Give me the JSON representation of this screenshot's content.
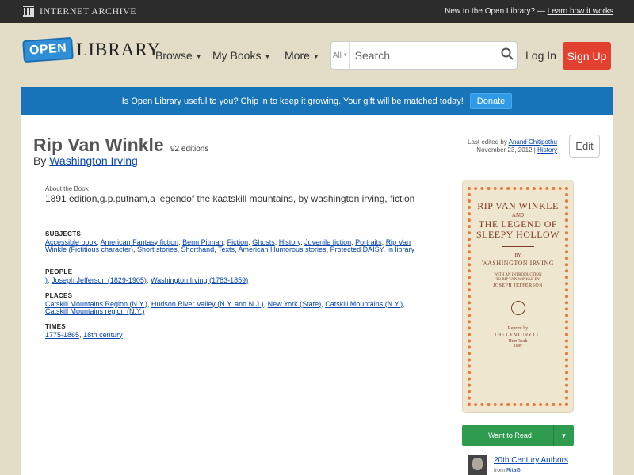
{
  "ia_bar": {
    "logo_text": "Internet Archive",
    "new_text": "New to the Open Library? —",
    "learn_link": "Learn how it works"
  },
  "header": {
    "logo_open": "OPEN",
    "logo_library": "LIBRARY",
    "nav": [
      {
        "label": "Browse"
      },
      {
        "label": "My Books"
      },
      {
        "label": "More"
      }
    ],
    "search": {
      "scope": "All",
      "placeholder": "Search"
    },
    "login": "Log In",
    "signup": "Sign Up"
  },
  "banner": {
    "text": "Is Open Library useful to you? Chip in to keep it growing. Your gift will be matched today!",
    "button": "Donate"
  },
  "book": {
    "title": "Rip Van Winkle",
    "editions": "92 editions",
    "by": "By",
    "author": "Washington Irving",
    "last_edited_prefix": "Last edited by",
    "last_edited_user": "Anand Chitipothu",
    "last_edited_date": "November 23, 2012 |",
    "history_link": "History",
    "edit_button": "Edit",
    "about_label": "About the Book",
    "about_text": "1891 edition,g.p.putnam,a legendof the kaatskill mountains, by washington irving, fiction"
  },
  "subjects": {
    "heading": "SUBJECTS",
    "items": [
      "Accessible book",
      "American Fantasy fiction",
      "Benn Pitman",
      "Fiction",
      "Ghosts",
      "History",
      "Juvenile fiction",
      "Portraits",
      "Rip Van Winkle (Fictitious character)",
      "Short stories",
      "Shorthand",
      "Texts",
      "American Humorous stories",
      "Protected DAISY",
      "In library"
    ]
  },
  "people": {
    "heading": "PEOPLE",
    "items": [
      ")",
      "Joseph Jefferson (1829-1905)",
      "Washington Irving (1783-1859)"
    ]
  },
  "places": {
    "heading": "PLACES",
    "items": [
      "Catskill Mountains Region (N.Y.)",
      "Hudson River Valley (N.Y. and N.J.)",
      "New York (State)",
      "Catskill Mountains (N.Y.)",
      "Catskill Mountains region (N.Y.)"
    ]
  },
  "times": {
    "heading": "TIMES",
    "items": [
      "1775-1865",
      "18th century"
    ]
  },
  "cover": {
    "title_line1": "RIP VAN WINKLE",
    "and": "AND",
    "title_line2": "THE LEGEND OF",
    "title_line3": "SLEEPY HOLLOW",
    "by": "BY",
    "author": "WASHINGTON IRVING",
    "intro1": "WITH AN INTRODUCTION",
    "intro2": "TO RIP VAN WINKLE BY",
    "intro3": "JOSEPH JEFFERSON",
    "reprint": "Reprint by",
    "publisher": "THE CENTURY CO.",
    "city": "New York",
    "year": "1889"
  },
  "actions": {
    "want_to_read": "Want to Read"
  },
  "lists": [
    {
      "name": "20th Century Authors",
      "from_prefix": "from",
      "from_user": "RitaG"
    }
  ]
}
